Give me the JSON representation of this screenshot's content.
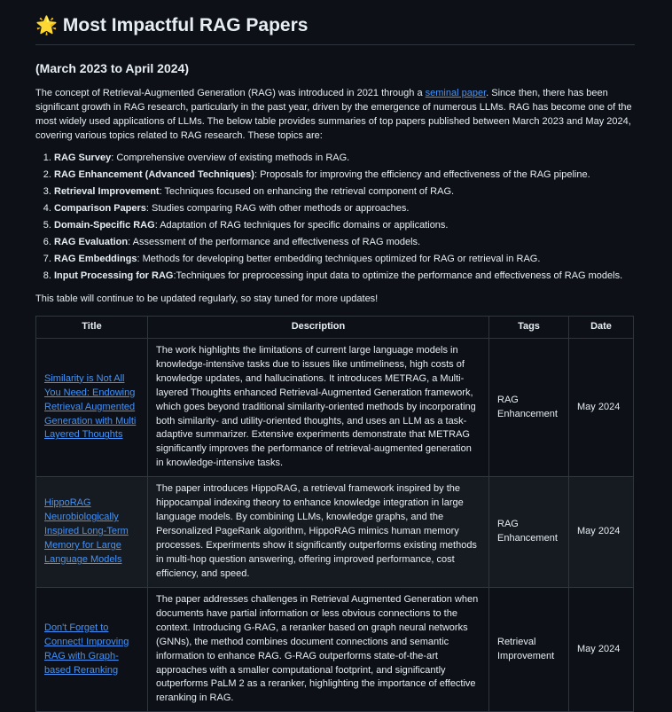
{
  "title": "Most Impactful RAG Papers",
  "title_icon": "glowing-star-icon",
  "subtitle": "(March 2023 to April 2024)",
  "intro": {
    "part1": "The concept of Retrieval-Augmented Generation (RAG) was introduced in 2021 through a ",
    "link": "seminal paper",
    "part2": ". Since then, there has been significant growth in RAG research, particularly in the past year, driven by the emergence of numerous LLMs. RAG has become one of the most widely used applications of LLMs. The below table provides summaries of top papers published between March 2023 and May 2024, covering various topics related to RAG research. These topics are:"
  },
  "topics": [
    {
      "name": "RAG Survey",
      "text": ": Comprehensive overview of existing methods in RAG."
    },
    {
      "name": "RAG Enhancement (Advanced Techniques)",
      "text": ": Proposals for improving the efficiency and effectiveness of the RAG pipeline."
    },
    {
      "name": "Retrieval Improvement",
      "text": ": Techniques focused on enhancing the retrieval component of RAG."
    },
    {
      "name": "Comparison Papers",
      "text": ": Studies comparing RAG with other methods or approaches."
    },
    {
      "name": "Domain-Specific RAG",
      "text": ": Adaptation of RAG techniques for specific domains or applications."
    },
    {
      "name": "RAG Evaluation",
      "text": ": Assessment of the performance and effectiveness of RAG models."
    },
    {
      "name": "RAG Embeddings",
      "text": ": Methods for developing better embedding techniques optimized for RAG or retrieval in RAG."
    },
    {
      "name": "Input Processing for RAG",
      "text": ":Techniques for preprocessing input data to optimize the performance and effectiveness of RAG models."
    }
  ],
  "note": "This table will continue to be updated regularly, so stay tuned for more updates!",
  "table": {
    "headers": [
      "Title",
      "Description",
      "Tags",
      "Date"
    ],
    "rows": [
      {
        "title": "Similarity is Not All You Need: Endowing Retrieval Augmented Generation with Multi Layered Thoughts",
        "description": "The work highlights the limitations of current large language models in knowledge-intensive tasks due to issues like untimeliness, high costs of knowledge updates, and hallucinations. It introduces METRAG, a Multi-layered Thoughts enhanced Retrieval-Augmented Generation framework, which goes beyond traditional similarity-oriented methods by incorporating both similarity- and utility-oriented thoughts, and uses an LLM as a task-adaptive summarizer. Extensive experiments demonstrate that METRAG significantly improves the performance of retrieval-augmented generation in knowledge-intensive tasks.",
        "tags": "RAG Enhancement",
        "date": "May 2024"
      },
      {
        "title": "HippoRAG Neurobiologically Inspired Long-Term Memory for Large Language Models",
        "description": "The paper introduces HippoRAG, a retrieval framework inspired by the hippocampal indexing theory to enhance knowledge integration in large language models. By combining LLMs, knowledge graphs, and the Personalized PageRank algorithm, HippoRAG mimics human memory processes. Experiments show it significantly outperforms existing methods in multi-hop question answering, offering improved performance, cost efficiency, and speed.",
        "tags": "RAG Enhancement",
        "date": "May 2024"
      },
      {
        "title": "Don't Forget to Connect! Improving RAG with Graph-based Reranking",
        "description": "The paper addresses challenges in Retrieval Augmented Generation when documents have partial information or less obvious connections to the context. Introducing G-RAG, a reranker based on graph neural networks (GNNs), the method combines document connections and semantic information to enhance RAG. G-RAG outperforms state-of-the-art approaches with a smaller computational footprint, and significantly outperforms PaLM 2 as a reranker, highlighting the importance of effective reranking in RAG.",
        "tags": "Retrieval Improvement",
        "date": "May 2024"
      }
    ]
  }
}
